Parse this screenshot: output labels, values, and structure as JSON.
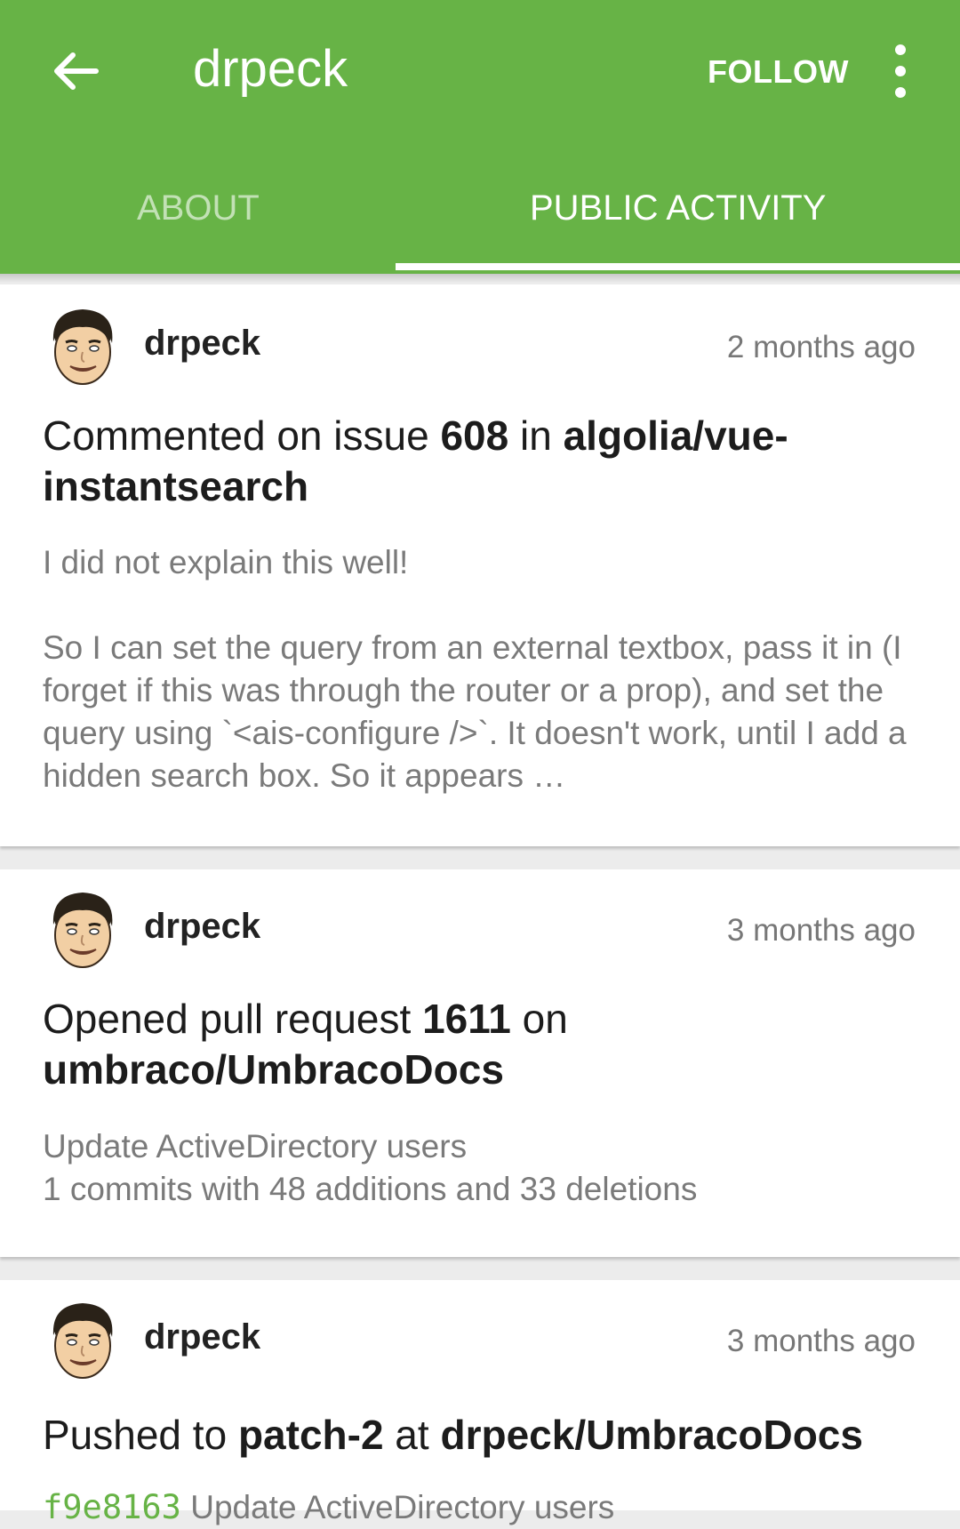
{
  "header": {
    "title": "drpeck",
    "follow_label": "FOLLOW",
    "tabs": [
      {
        "label": "ABOUT",
        "active": false
      },
      {
        "label": "PUBLIC ACTIVITY",
        "active": true
      }
    ]
  },
  "colors": {
    "accent": "#67b346",
    "card_bg": "#ffffff",
    "page_bg": "#ececec"
  },
  "events": [
    {
      "user": "drpeck",
      "time": "2 months ago",
      "action": "Commented on issue ",
      "number": "608",
      "preposition": " in ",
      "repo": "algolia/vue-instantsearch",
      "body_line1": "I did not explain this well!",
      "body_para2": "So I can set the query from an external textbox, pass it in (I forget if this was through the router or a prop), and set the query using `<ais-configure />`. It doesn't work, until I add a hidden search box. So it appears …"
    },
    {
      "user": "drpeck",
      "time": "3 months ago",
      "action": "Opened pull request ",
      "number": "1611",
      "preposition": " on ",
      "repo": "umbraco/UmbracoDocs",
      "body_line1": "Update ActiveDirectory users",
      "body_line2": "1 commits with 48 additions and 33 deletions"
    },
    {
      "user": "drpeck",
      "time": "3 months ago",
      "action": "Pushed to ",
      "branch": "patch-2",
      "preposition": " at ",
      "repo": "drpeck/UmbracoDocs",
      "commit_sha": "f9e8163",
      "commit_message": " Update ActiveDirectory users"
    }
  ]
}
